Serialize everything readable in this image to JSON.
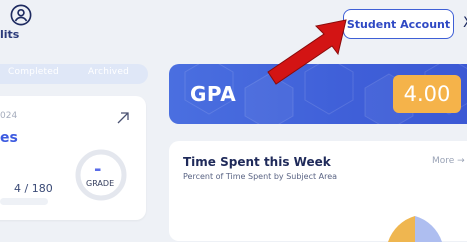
{
  "header": {
    "profile_label": "lits",
    "student_account_label": "Student Account",
    "close_glyph": "X"
  },
  "tabs": [
    {
      "label": "Completed"
    },
    {
      "label": "Archived"
    }
  ],
  "course_card": {
    "year": "024",
    "title": "es",
    "progress_text": "4 / 180",
    "grade_value": "-",
    "grade_label": "GRADE"
  },
  "gpa": {
    "label": "GPA",
    "value": "4.00"
  },
  "time_card": {
    "title": "Time Spent this Week",
    "subtitle": "Percent of Time Spent by Subject Area",
    "more_label": "More →"
  },
  "colors": {
    "accent": "#3e5fd6",
    "gpa_badge": "#f5b34a",
    "pointer_red": "#d31414"
  },
  "icons": [
    "user-circle-icon",
    "external-arrow-icon",
    "pointer-arrow-icon"
  ]
}
